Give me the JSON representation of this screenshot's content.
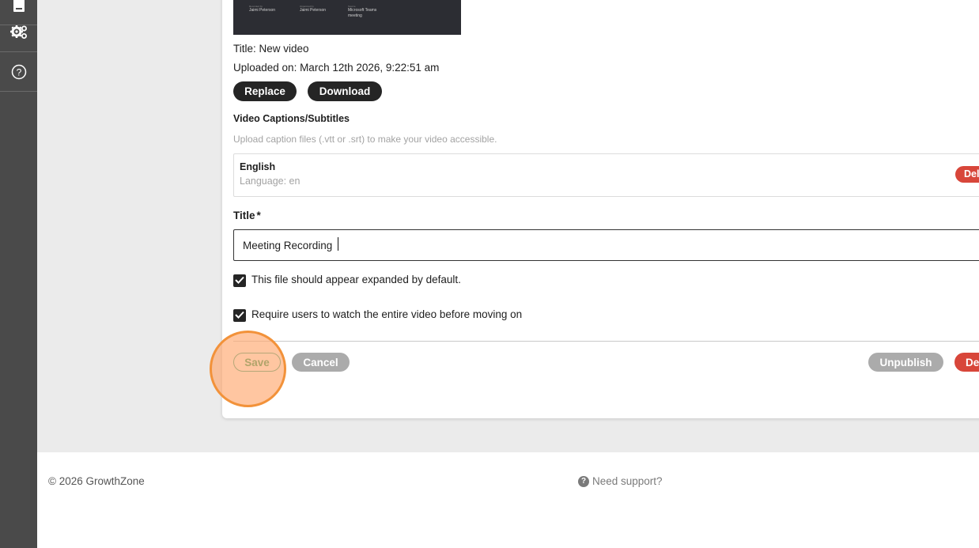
{
  "sidebar": {
    "items": [
      {
        "icon": "document-icon"
      },
      {
        "icon": "gears-icon"
      },
      {
        "icon": "help-circle-icon"
      }
    ]
  },
  "video": {
    "thumbnail": {
      "columns": [
        {
          "label": "Recorded by",
          "value": "Jaimi Peterson"
        },
        {
          "label": "Organized by",
          "value": "Jaimi Peterson"
        },
        {
          "label": "Source",
          "value": "Microsoft Teams meeting"
        }
      ]
    },
    "title_line": "Title: New video",
    "uploaded_line": "Uploaded on: March 12th 2026, 9:22:51 am",
    "replace_label": "Replace",
    "download_label": "Download"
  },
  "captions": {
    "heading": "Video Captions/Subtitles",
    "hint": "Upload caption files (.vtt or .srt) to make your video accessible.",
    "items": [
      {
        "name": "English",
        "language": "Language: en",
        "delete_label": "Delete"
      }
    ]
  },
  "form": {
    "title_label": "Title",
    "required_marker": "*",
    "title_value": "Meeting Recording",
    "expanded_checkbox": {
      "label": "This file should appear expanded by default.",
      "checked": true
    },
    "watch_checkbox": {
      "label": "Require users to watch the entire video before moving on",
      "checked": true
    }
  },
  "actions": {
    "save_label": "Save",
    "cancel_label": "Cancel",
    "unpublish_label": "Unpublish",
    "delete_label": "Delete"
  },
  "footer": {
    "copyright": "© 2026 GrowthZone",
    "support": "Need support?"
  },
  "colors": {
    "sidebar": "#4a4a4a",
    "dark_button": "#252525",
    "grey_button": "#ababab",
    "danger": "#d8463a",
    "highlight": "#f2923a"
  }
}
